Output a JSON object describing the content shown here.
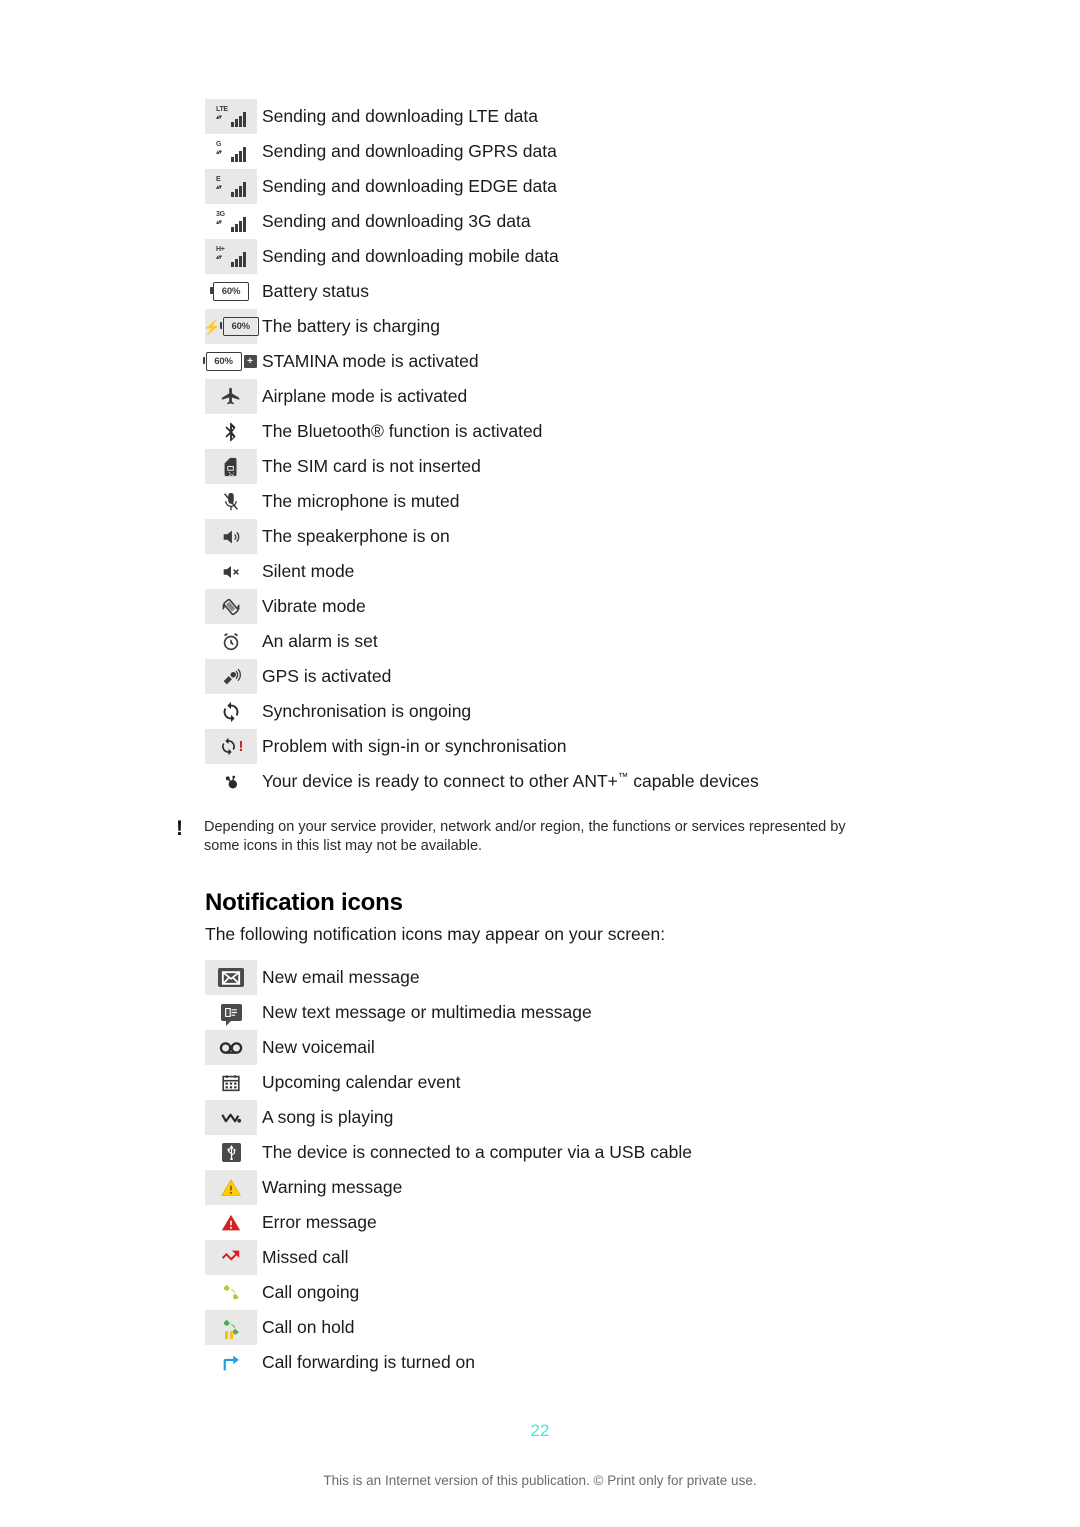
{
  "status_icons": [
    {
      "icon": "signal-lte-icon",
      "tech": "LTE",
      "label": "Sending and downloading LTE data",
      "shaded": true
    },
    {
      "icon": "signal-gprs-icon",
      "tech": "G",
      "label": "Sending and downloading GPRS data",
      "shaded": false
    },
    {
      "icon": "signal-edge-icon",
      "tech": "E",
      "label": "Sending and downloading EDGE data",
      "shaded": true
    },
    {
      "icon": "signal-3g-icon",
      "tech": "3G",
      "label": "Sending and downloading 3G data",
      "shaded": false
    },
    {
      "icon": "signal-hspa-icon",
      "tech": "H+",
      "label": "Sending and downloading mobile data",
      "shaded": true
    },
    {
      "icon": "battery-status-icon",
      "tech": "",
      "label": "Battery status",
      "shaded": false
    },
    {
      "icon": "battery-charging-icon",
      "tech": "",
      "label": "The battery is charging",
      "shaded": true
    },
    {
      "icon": "stamina-mode-icon",
      "tech": "",
      "label": "STAMINA mode is activated",
      "shaded": false
    },
    {
      "icon": "airplane-mode-icon",
      "tech": "",
      "label": "Airplane mode is activated",
      "shaded": true
    },
    {
      "icon": "bluetooth-icon",
      "tech": "",
      "label": "The Bluetooth® function is activated",
      "shaded": false
    },
    {
      "icon": "sim-card-missing-icon",
      "tech": "",
      "label": "The SIM card is not inserted",
      "shaded": true
    },
    {
      "icon": "microphone-muted-icon",
      "tech": "",
      "label": "The microphone is muted",
      "shaded": false
    },
    {
      "icon": "speakerphone-icon",
      "tech": "",
      "label": "The speakerphone is on",
      "shaded": true
    },
    {
      "icon": "silent-mode-icon",
      "tech": "",
      "label": "Silent mode",
      "shaded": false
    },
    {
      "icon": "vibrate-mode-icon",
      "tech": "",
      "label": "Vibrate mode",
      "shaded": true
    },
    {
      "icon": "alarm-icon",
      "tech": "",
      "label": "An alarm is set",
      "shaded": false
    },
    {
      "icon": "gps-icon",
      "tech": "",
      "label": "GPS is activated",
      "shaded": true
    },
    {
      "icon": "sync-icon",
      "tech": "",
      "label": "Synchronisation is ongoing",
      "shaded": false
    },
    {
      "icon": "sync-problem-icon",
      "tech": "",
      "label": "Problem with sign-in or synchronisation",
      "shaded": true
    },
    {
      "icon": "ant-plus-icon",
      "tech": "",
      "label": "Your device is ready to connect  to other ANT+™ capable devices",
      "shaded": false
    }
  ],
  "battery_level": "60%",
  "note": {
    "marker": "!",
    "text": "Depending on your service provider, network and/or region, the functions or services represented by some icons in this list may not be available."
  },
  "notification_section": {
    "heading": "Notification icons",
    "intro": "The following notification icons may appear on your screen:"
  },
  "notification_icons": [
    {
      "icon": "email-icon",
      "label": "New email message",
      "shaded": true
    },
    {
      "icon": "text-message-icon",
      "label": "New text message or multimedia message",
      "shaded": false
    },
    {
      "icon": "voicemail-icon",
      "label": "New voicemail",
      "shaded": true
    },
    {
      "icon": "calendar-event-icon",
      "label": "Upcoming calendar event",
      "shaded": false
    },
    {
      "icon": "music-playing-icon",
      "label": "A song is playing",
      "shaded": true
    },
    {
      "icon": "usb-connected-icon",
      "label": "The device is connected to a computer via a USB cable",
      "shaded": false
    },
    {
      "icon": "warning-icon",
      "label": "Warning message",
      "shaded": true
    },
    {
      "icon": "error-icon",
      "label": "Error message",
      "shaded": false
    },
    {
      "icon": "missed-call-icon",
      "label": "Missed call",
      "shaded": true
    },
    {
      "icon": "call-ongoing-icon",
      "label": "Call ongoing",
      "shaded": false
    },
    {
      "icon": "call-on-hold-icon",
      "label": "Call on hold",
      "shaded": true
    },
    {
      "icon": "call-forwarding-icon",
      "label": "Call forwarding is turned on",
      "shaded": false
    }
  ],
  "footer": {
    "page_number": "22",
    "notice": "This is an Internet version of this publication. © Print only for private use."
  },
  "colors": {
    "page_number": "#45e6da",
    "warning": "#ffcc00",
    "error": "#d32121",
    "missed_call": "#e02020",
    "call_ongoing": "#b5cc3a",
    "call_on_hold": "#4caf50",
    "call_forwarding": "#1e9fe0",
    "shade": "#e8e8e8"
  }
}
